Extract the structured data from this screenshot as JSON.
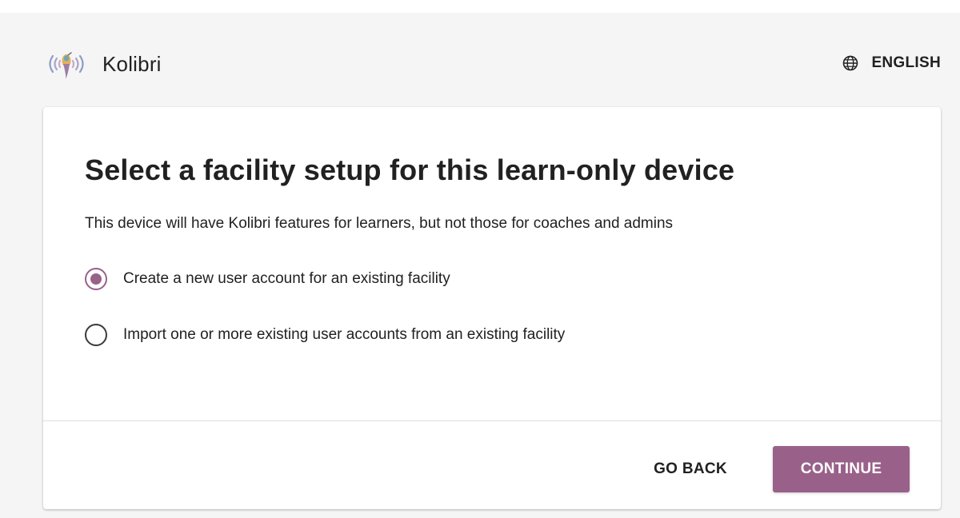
{
  "app": {
    "name": "Kolibri",
    "language_label": "ENGLISH"
  },
  "card": {
    "title": "Select a facility setup for this learn-only device",
    "description": "This device will have Kolibri features for learners, but not those for coaches and admins",
    "options": [
      {
        "label": "Create a new user account for an existing facility",
        "selected": true
      },
      {
        "label": "Import one or more existing user accounts from an existing facility",
        "selected": false
      }
    ]
  },
  "actions": {
    "back_label": "GO BACK",
    "continue_label": "CONTINUE"
  },
  "icons": {
    "logo": "kolibri-logo-icon",
    "language": "globe-icon"
  },
  "colors": {
    "accent": "#996189",
    "background": "#f5f5f5",
    "card": "#ffffff",
    "text": "#212121"
  }
}
